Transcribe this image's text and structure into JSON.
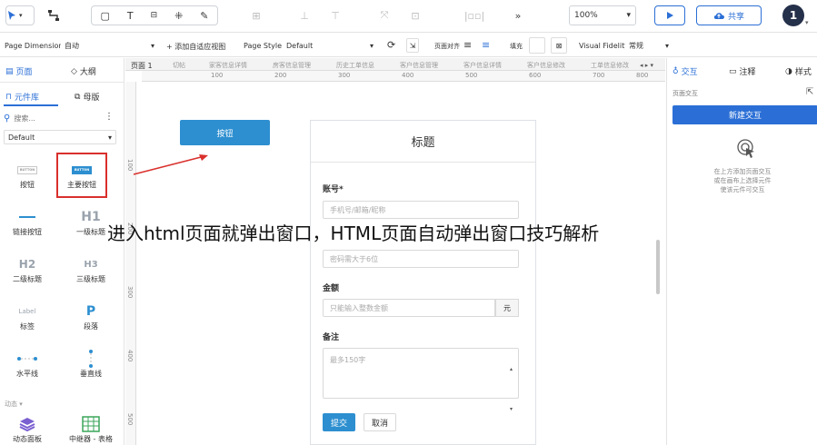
{
  "toolbar": {
    "zoom_value": "100%",
    "share_label": "共享",
    "avatar_text": "1",
    "chevrons": "»"
  },
  "propbar": {
    "page_dimensions_label": "Page Dimensions",
    "page_dimensions_value": "自动",
    "add_adaptive_view": "+ 添加自适应视图",
    "page_style_label": "Page Style",
    "page_style_value": "Default",
    "page_align_label": "页面对齐",
    "fill_label": "填充",
    "visual_fidelity_label": "Visual Fidelity",
    "visual_fidelity_value": "常规"
  },
  "left_panel": {
    "tab_pages": "页面",
    "tab_outline": "大纲",
    "tab_library": "元件库",
    "tab_masters": "母版",
    "search_placeholder": "搜索...",
    "library_select": "Default",
    "components": [
      {
        "icon_text": "BUTTON",
        "label": "按钮"
      },
      {
        "icon_text": "BUTTON",
        "label": "主要按钮"
      },
      {
        "icon_text": "",
        "label": "链接按钮"
      },
      {
        "icon_text": "H1",
        "label": "一级标题"
      },
      {
        "icon_text": "H2",
        "label": "二级标题"
      },
      {
        "icon_text": "H3",
        "label": "三级标题"
      },
      {
        "icon_text": "Label",
        "label": "标签"
      },
      {
        "icon_text": "P",
        "label": "段落"
      },
      {
        "icon_text": "",
        "label": "水平线"
      },
      {
        "icon_text": "",
        "label": "垂直线"
      },
      {
        "icon_text": "",
        "label": "动态面板"
      },
      {
        "icon_text": "",
        "label": "中继器 - 表格"
      }
    ],
    "section_dynamic": "动态 ▾"
  },
  "canvas": {
    "page_tabs": [
      "页面 1",
      "切帖",
      "家客信息详情",
      "房客信息管理",
      "历史工单信息",
      "客户信息管理",
      "客户信息详情",
      "客户信息修改",
      "工单信息修改"
    ],
    "ruler_ticks": [
      "100",
      "200",
      "300",
      "400",
      "500",
      "600",
      "700",
      "800"
    ],
    "ruler_v_ticks": [
      "100",
      "200",
      "300",
      "400",
      "500"
    ],
    "button_label": "按钮",
    "form": {
      "title": "标题",
      "account_label": "账号*",
      "account_placeholder": "手机号/邮箱/昵称",
      "password_placeholder": "密码需大于6位",
      "amount_label": "金额",
      "amount_placeholder": "只能输入整数金额",
      "amount_unit": "元",
      "remark_label": "备注",
      "remark_placeholder": "最多150字",
      "submit_label": "提交",
      "cancel_label": "取消"
    }
  },
  "right_panel": {
    "tab_interactions": "交互",
    "tab_notes": "注释",
    "tab_style": "样式",
    "page_interactions_label": "页面交互",
    "new_interaction_button": "新建交互",
    "hint_line1": "在上方添加页面交互",
    "hint_line2": "或在画布上选择元件",
    "hint_line3": "使该元件可交互"
  },
  "overlay_caption": "进入html页面就弹出窗口，HTML页面自动弹出窗口技巧解析",
  "colors": {
    "accent": "#2b6fd6",
    "primary_button": "#2d8fd0",
    "highlight_box": "#d9302c"
  }
}
